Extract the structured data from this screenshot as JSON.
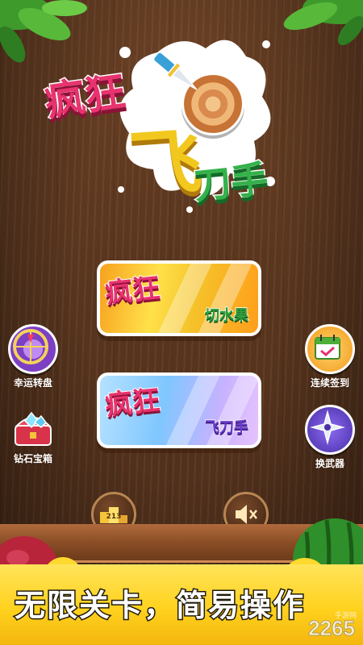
{
  "title": {
    "word1": "疯狂",
    "word2": "飞",
    "word3": "刀手"
  },
  "modes": [
    {
      "big": "疯狂",
      "small": "切水果"
    },
    {
      "big": "疯狂",
      "small": "飞刀手"
    }
  ],
  "side_left": [
    {
      "label": "幸运转盘",
      "icon": "wheel-icon"
    },
    {
      "label": "钻石宝箱",
      "icon": "treasure-chest-icon"
    }
  ],
  "side_right": [
    {
      "label": "连续签到",
      "icon": "calendar-icon"
    },
    {
      "label": "换武器",
      "icon": "shuriken-icon"
    }
  ],
  "bottom_buttons": [
    {
      "label": "排行",
      "icon": "podium-icon",
      "glyph": "213"
    },
    {
      "label": "声音",
      "icon": "speaker-mute-icon"
    }
  ],
  "slogan": "无限关卡，简易操作",
  "watermark": {
    "main": "2265",
    "sub": "手游网"
  },
  "colors": {
    "title_pink": "#e8336f",
    "title_green": "#34b24a",
    "banner_yellow": "#ffd21e"
  }
}
